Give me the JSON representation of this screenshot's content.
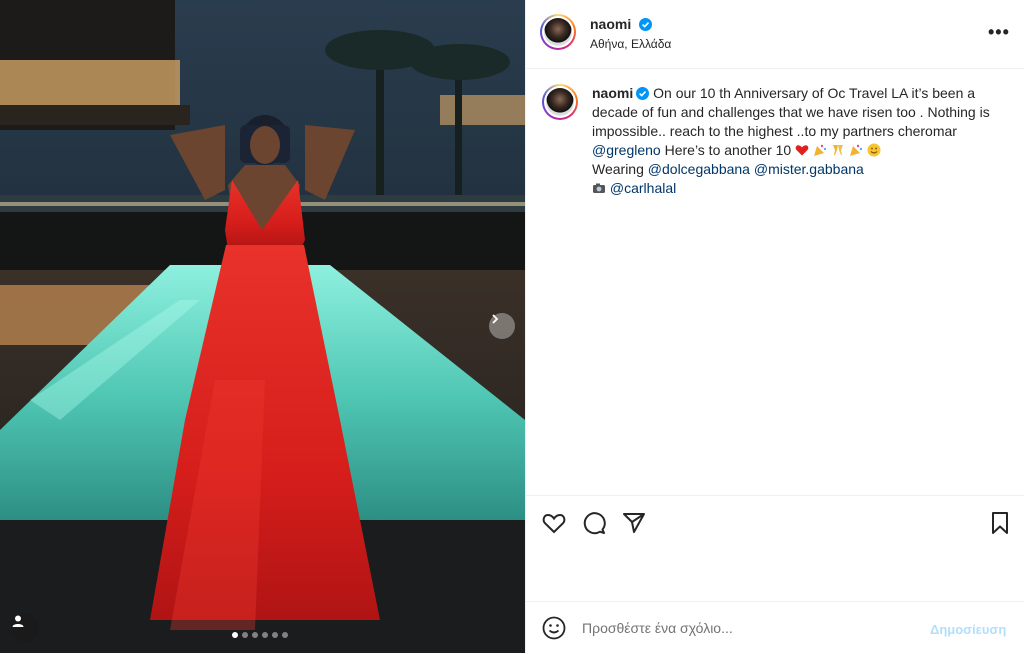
{
  "post": {
    "username": "naomi",
    "location": "Αθήνα, Ελλάδα",
    "caption": {
      "line1": "On our 10 th Anniversary of Oc Travel LA it’s been a decade of fun and challenges that we have risen too . Nothing is impossible.. reach to the highest ..to my partners cheromar",
      "mention1": "@gregleno",
      "line2": " Here’s to another 10 ",
      "wearing": "Wearing ",
      "mention2": "@dolcegabbana",
      "mention3": "@mister.gabbana",
      "mention4": "@carlhalal"
    },
    "carousel": {
      "total": 6,
      "active": 0
    }
  },
  "comment": {
    "placeholder": "Προσθέστε ένα σχόλιο...",
    "post_label": "Δημοσίευση"
  },
  "icons": {
    "verified": "verified-badge-icon",
    "more": "more-options-icon",
    "like": "heart-icon",
    "comment": "comment-icon",
    "share": "paper-plane-icon",
    "save": "bookmark-icon",
    "emoji": "smiley-icon",
    "next": "chevron-right-icon",
    "tags": "user-tag-icon"
  },
  "colors": {
    "accent_link": "#00376b",
    "verified": "#0095f6",
    "dress": "#e0201c",
    "pool": "#5fd3c4"
  }
}
